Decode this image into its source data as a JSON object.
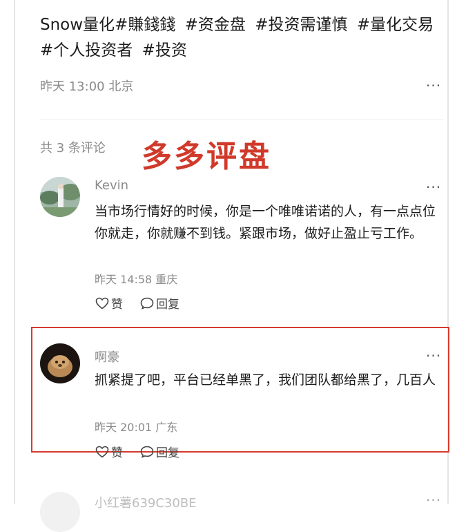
{
  "post": {
    "tags": [
      "Snow量化#賺錢錢",
      "#资金盘",
      "#投资需谨慎",
      "#量化交易",
      "#个人投资者",
      "#投资"
    ],
    "time": "昨天 13:00",
    "location": "北京",
    "more_label": "···"
  },
  "comments_section": {
    "count_label": "共 3 条评论",
    "overlay_title": "多多评盘"
  },
  "comments": [
    {
      "user": "Kevin",
      "text": "当市场行情好的时候，你是一个唯唯诺诺的人，有一点点位你就走，你就赚不到钱。紧跟市场，做好止盈止亏工作。",
      "time": "昨天 14:58",
      "location": "重庆",
      "like_label": "赞",
      "reply_label": "回复",
      "more_label": "···"
    },
    {
      "user": "啊豪",
      "text": "抓紧提了吧，平台已经单黑了，我们团队都给黑了，几百人",
      "time": "昨天 20:01",
      "location": "广东",
      "like_label": "赞",
      "reply_label": "回复",
      "more_label": "···"
    },
    {
      "user": "小红薯639C30BE",
      "more_label": "···"
    }
  ],
  "colors": {
    "highlight": "#d63a2d",
    "overlay_text": "#d1392a",
    "meta_gray": "#8a8a8a"
  }
}
